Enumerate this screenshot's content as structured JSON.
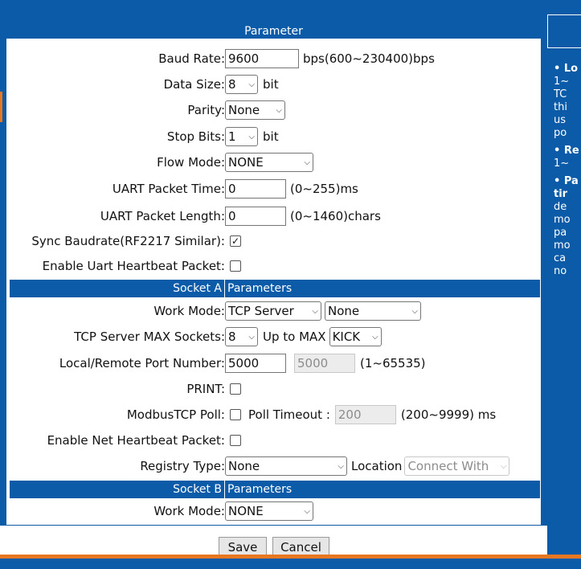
{
  "panel": {
    "title": "Parameter"
  },
  "uart": {
    "baud_rate": {
      "label": "Baud Rate:",
      "value": "9600",
      "suffix": "bps(600~230400)bps"
    },
    "data_size": {
      "label": "Data Size:",
      "value": "8",
      "suffix": "bit"
    },
    "parity": {
      "label": "Parity:",
      "value": "None"
    },
    "stop_bits": {
      "label": "Stop Bits:",
      "value": "1",
      "suffix": "bit"
    },
    "flow_mode": {
      "label": "Flow Mode:",
      "value": "NONE"
    },
    "packet_time": {
      "label": "UART Packet Time:",
      "value": "0",
      "suffix": "(0~255)ms"
    },
    "packet_length": {
      "label": "UART Packet Length:",
      "value": "0",
      "suffix": "(0~1460)chars"
    },
    "sync_baudrate": {
      "label": "Sync Baudrate(RF2217 Similar):",
      "checked": true,
      "checkmark": "✓"
    },
    "uart_heartbeat": {
      "label": "Enable Uart Heartbeat Packet:",
      "checked": false
    }
  },
  "socket_a": {
    "header_left": "Socket A",
    "header_right": "Parameters",
    "work_mode": {
      "label": "Work Mode:",
      "value": "TCP Server",
      "value2": "None"
    },
    "max_sockets": {
      "label": "TCP Server MAX Sockets:",
      "value": "8",
      "middle": "Up to MAX",
      "value2": "KICK"
    },
    "port": {
      "label": "Local/Remote Port Number:",
      "local": "5000",
      "remote": "5000",
      "suffix": "(1~65535)"
    },
    "print": {
      "label": "PRINT:",
      "checked": false
    },
    "modbus": {
      "label": "ModbusTCP Poll:",
      "checked": false,
      "timeout_label": "Poll Timeout :",
      "timeout": "200",
      "suffix": "(200~9999) ms"
    },
    "net_heartbeat": {
      "label": "Enable Net Heartbeat Packet:",
      "checked": false
    },
    "registry": {
      "label": "Registry Type:",
      "value": "None",
      "location_label": "Location",
      "location_value": "Connect With"
    }
  },
  "socket_b": {
    "header_left": "Socket B",
    "header_right": "Parameters",
    "work_mode": {
      "label": "Work Mode:",
      "value": "NONE"
    }
  },
  "buttons": {
    "save": "Save",
    "cancel": "Cancel"
  },
  "help": {
    "items": [
      {
        "title": "Lo",
        "lines": [
          "1~",
          "TC",
          "thi",
          "us",
          "po"
        ]
      },
      {
        "title": "Re",
        "lines": [
          "1~"
        ]
      },
      {
        "title": "Pa",
        "lines": [
          "tir",
          "de",
          "mo",
          "pa",
          "mo",
          "ca",
          "no"
        ]
      }
    ]
  },
  "colors": {
    "brand_blue": "#0b5ba8",
    "accent_orange": "#e87722"
  },
  "icons": {
    "dropdown": "chevron-down-icon",
    "check": "checkmark-icon"
  }
}
